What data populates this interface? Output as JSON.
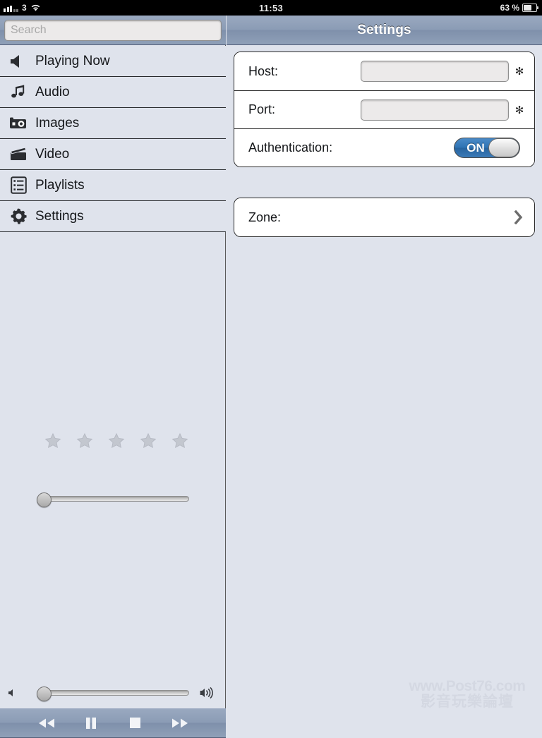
{
  "status_bar": {
    "carrier": "3",
    "signal_icon": "signal-bars-icon",
    "wifi_icon": "wifi-icon",
    "time": "11:53",
    "battery_percent": "63 %",
    "battery_icon": "battery-icon"
  },
  "sidebar": {
    "search": {
      "value": "",
      "placeholder": "Search"
    },
    "items": [
      {
        "label": "Playing Now",
        "icon": "speaker-icon"
      },
      {
        "label": "Audio",
        "icon": "music-note-icon"
      },
      {
        "label": "Images",
        "icon": "camera-icon"
      },
      {
        "label": "Video",
        "icon": "clapperboard-icon"
      },
      {
        "label": "Playlists",
        "icon": "list-icon"
      },
      {
        "label": "Settings",
        "icon": "gear-icon"
      }
    ],
    "rating": {
      "max": 5,
      "value": 0
    },
    "position_slider": {
      "value": 0,
      "min": 0,
      "max": 100
    },
    "volume": {
      "value": 0,
      "min": 0,
      "max": 100,
      "low_icon": "volume-low-icon",
      "high_icon": "volume-high-icon"
    },
    "transport": [
      {
        "name": "rewind-button",
        "icon": "rewind-icon"
      },
      {
        "name": "pause-button",
        "icon": "pause-icon"
      },
      {
        "name": "stop-button",
        "icon": "stop-icon"
      },
      {
        "name": "forward-button",
        "icon": "fast-forward-icon"
      }
    ]
  },
  "detail": {
    "title": "Settings",
    "connection": {
      "host": {
        "label": "Host:",
        "value": "",
        "placeholder": "",
        "required_marker": "✻"
      },
      "port": {
        "label": "Port:",
        "value": "",
        "placeholder": "",
        "required_marker": "✻"
      },
      "authentication": {
        "label": "Authentication:",
        "state": "ON"
      }
    },
    "zone": {
      "label": "Zone:",
      "disclosure_icon": "chevron-right-icon"
    }
  },
  "watermark": {
    "line1": "www.Post76.com",
    "line2": "影音玩樂論壇"
  },
  "colors": {
    "chrome": "#8b9cb5",
    "background": "#dfe3ec",
    "toggle_on": "#2f73b4",
    "separator": "#27292c"
  }
}
